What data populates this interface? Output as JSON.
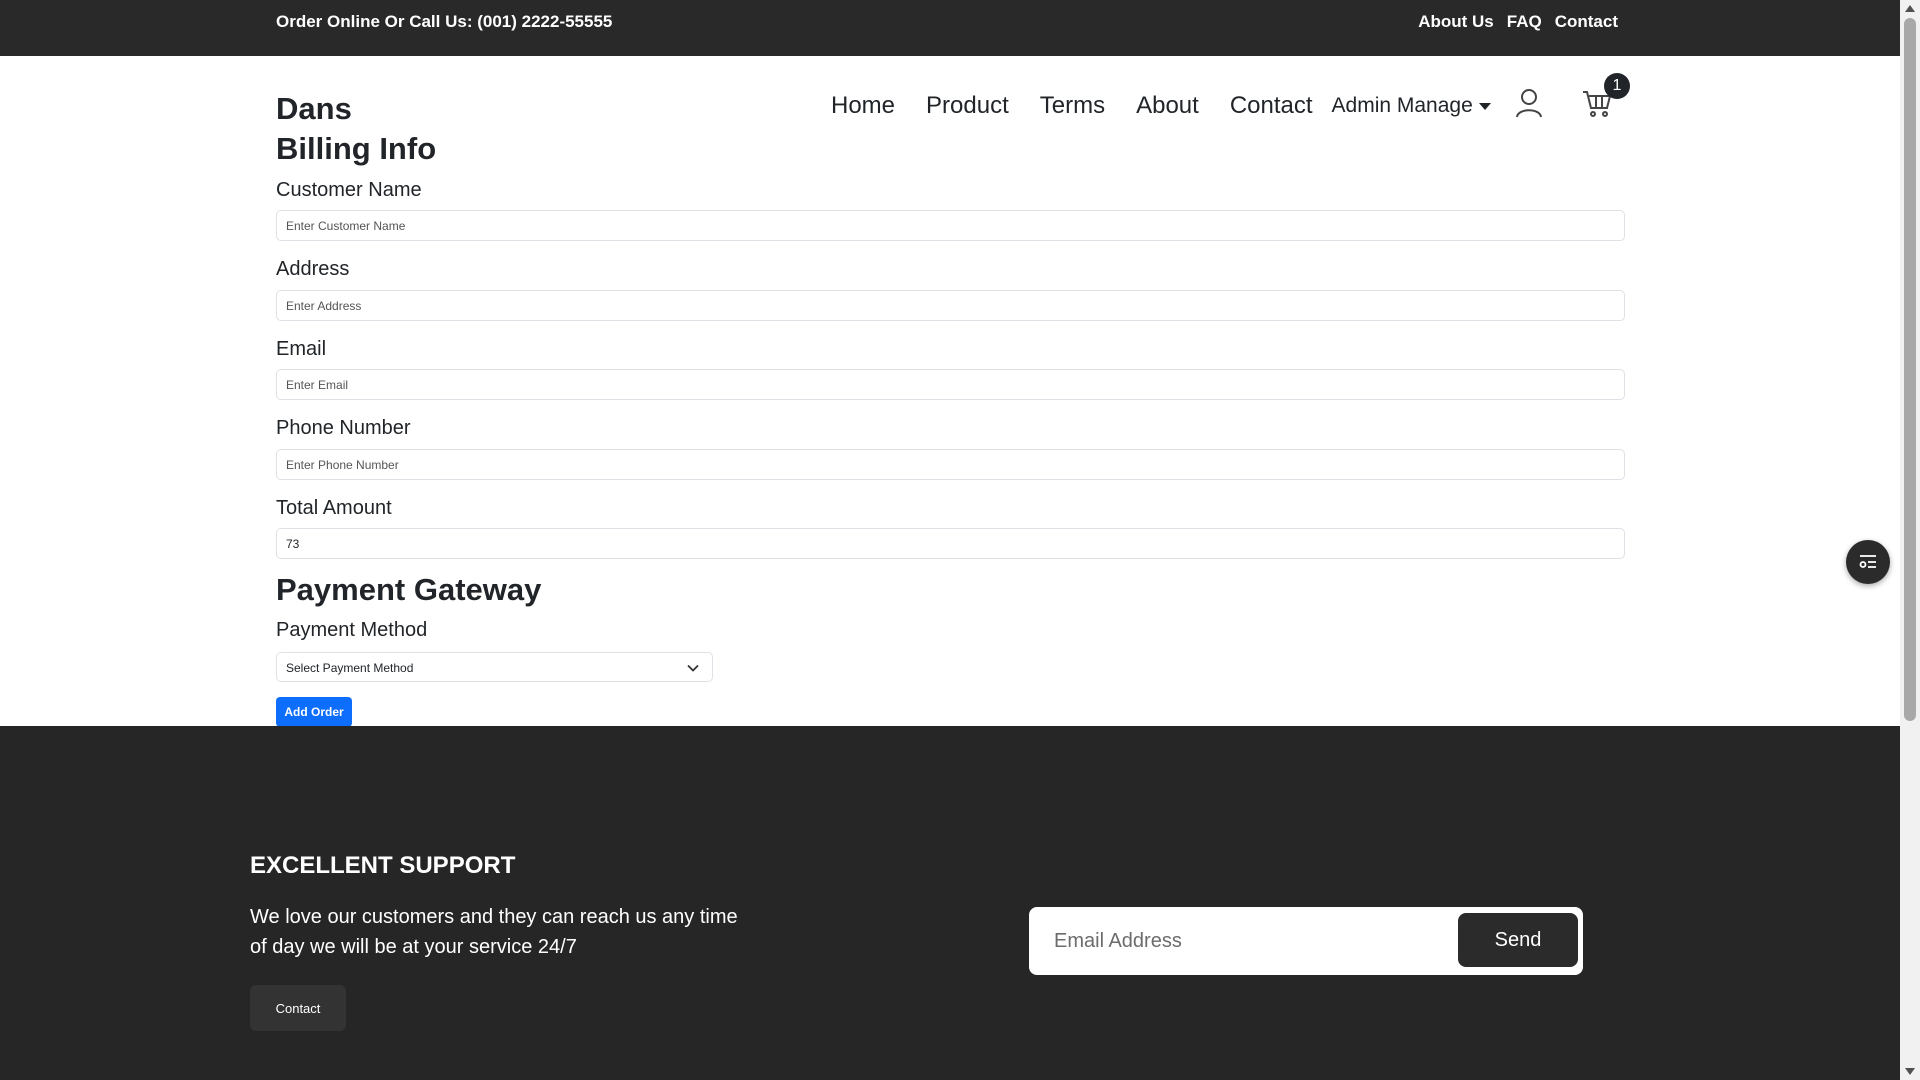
{
  "topbar": {
    "phone_text": "Order Online Or Call Us: (001) 2222-55555",
    "links": [
      "About Us",
      "FAQ",
      "Contact"
    ]
  },
  "header": {
    "brand": "Dans",
    "nav": [
      "Home",
      "Product",
      "Terms",
      "About",
      "Contact"
    ],
    "admin_dropdown": "Admin Manage",
    "cart_count": "1"
  },
  "form": {
    "title": "Billing Info",
    "fields": [
      {
        "label": "Customer Name",
        "placeholder": "Enter Customer Name",
        "value": ""
      },
      {
        "label": "Address",
        "placeholder": "Enter Address",
        "value": ""
      },
      {
        "label": "Email",
        "placeholder": "Enter Email",
        "value": ""
      },
      {
        "label": "Phone Number",
        "placeholder": "Enter Phone Number",
        "value": ""
      },
      {
        "label": "Total Amount",
        "placeholder": "",
        "value": "73"
      }
    ],
    "payment_title": "Payment Gateway",
    "payment_label": "Payment Method",
    "payment_selected": "Select Payment Method",
    "submit_label": "Add Order"
  },
  "footer": {
    "support_title": "EXCELLENT SUPPORT",
    "support_text": "We love our customers and they can reach us any time of day we will be at your service 24/7",
    "contact_button": "Contact",
    "email_placeholder": "Email Address",
    "send_button": "Send"
  },
  "colors": {
    "topbar_bg": "#292929",
    "footer_bg": "#262626",
    "primary_button": "#0d6efd"
  },
  "icons": [
    "user-icon",
    "cart-icon",
    "chevron-down-icon",
    "filter-list-icon"
  ]
}
